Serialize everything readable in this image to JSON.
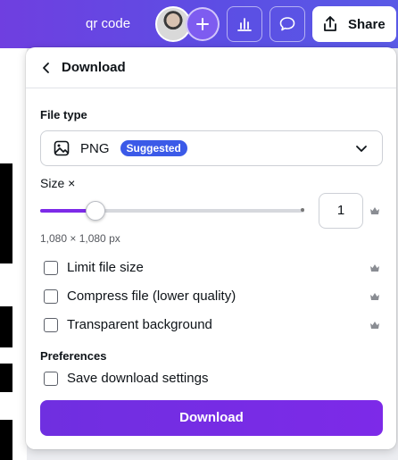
{
  "topbar": {
    "doc_title": "qr code",
    "share_label": "Share"
  },
  "panel": {
    "title": "Download",
    "file_type_label": "File type",
    "file_type_value": "PNG",
    "suggested_badge": "Suggested",
    "size_label": "Size ×",
    "size_value": "1",
    "size_slider_fraction": 0.21,
    "dimensions": "1,080 × 1,080 px",
    "options": [
      {
        "label": "Limit file size",
        "checked": false
      },
      {
        "label": "Compress file (lower quality)",
        "checked": false
      },
      {
        "label": "Transparent background",
        "checked": false
      }
    ],
    "preferences_label": "Preferences",
    "save_settings_label": "Save download settings",
    "download_button": "Download"
  },
  "colors": {
    "accent": "#7d2ae8",
    "badge": "#3b5ae8",
    "topbar": "#6f3fe0"
  }
}
